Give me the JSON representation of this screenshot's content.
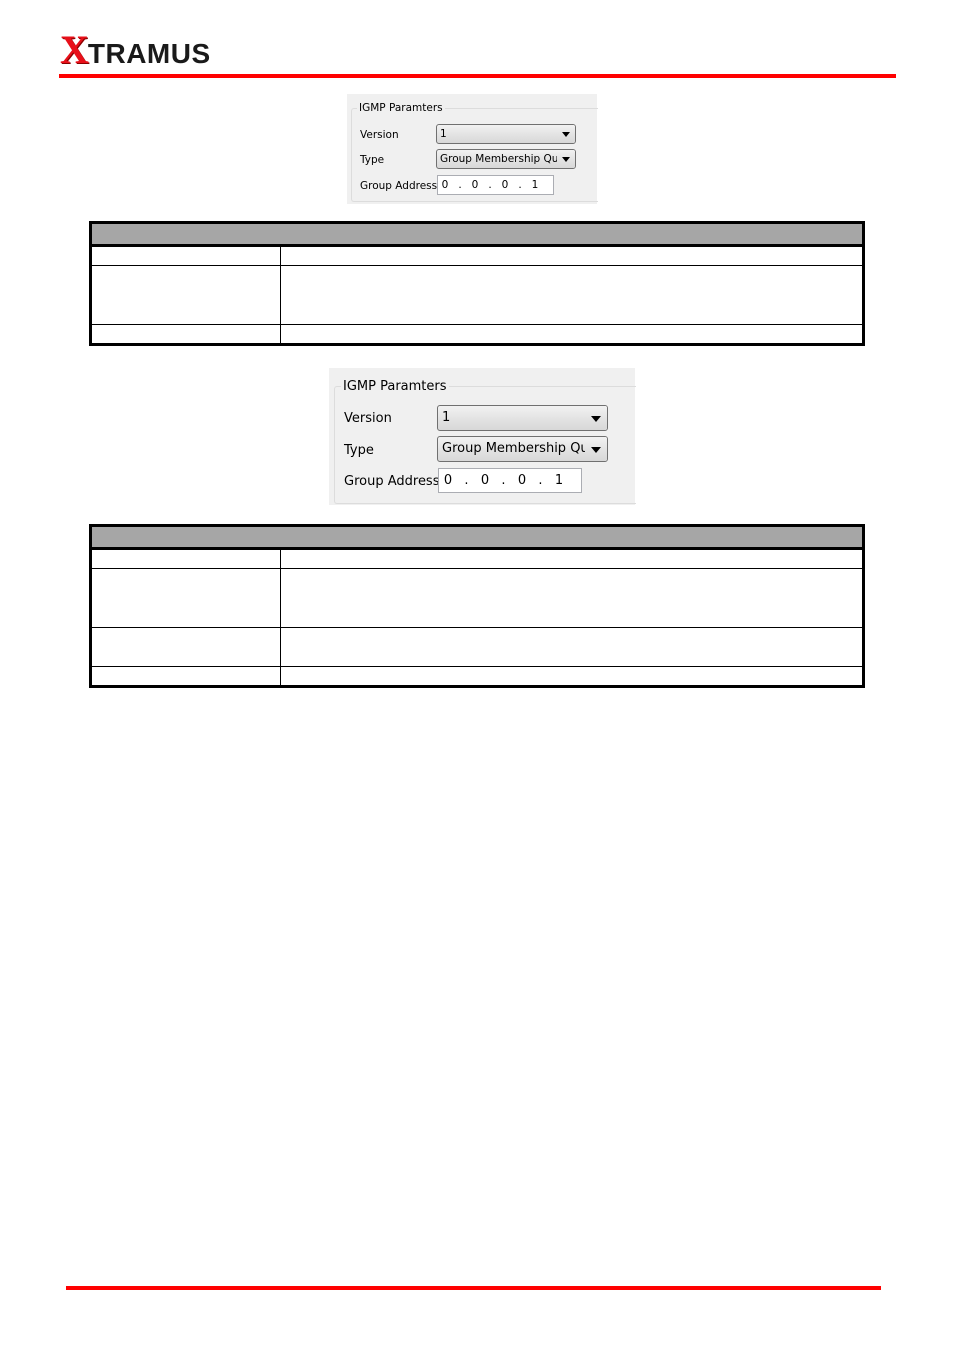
{
  "header": {
    "logo_first": "X",
    "logo_rest": "TRAMUS",
    "brand_color": "#ff0000"
  },
  "figures": [
    {
      "group_title": "IGMP Paramters",
      "version_label": "Version",
      "version_value": "1",
      "type_label": "Type",
      "type_value": "Group Membership Query",
      "group_address_label": "Group Address",
      "group_address_octets": [
        "0",
        "0",
        "0",
        "1"
      ],
      "dot": "."
    },
    {
      "group_title": "IGMP Paramters",
      "version_label": "Version",
      "version_value": "1",
      "type_label": "Type",
      "type_value": "Group Membership Query",
      "group_address_label": "Group Address",
      "group_address_octets": [
        "0",
        "0",
        "0",
        "1"
      ],
      "dot": "."
    }
  ],
  "tables": [
    {
      "header": "",
      "rows": [
        [
          "",
          ""
        ],
        [
          "",
          ""
        ],
        [
          "",
          ""
        ]
      ]
    },
    {
      "header": "",
      "rows": [
        [
          "",
          ""
        ],
        [
          "",
          ""
        ],
        [
          "",
          ""
        ],
        [
          "",
          ""
        ]
      ]
    }
  ]
}
